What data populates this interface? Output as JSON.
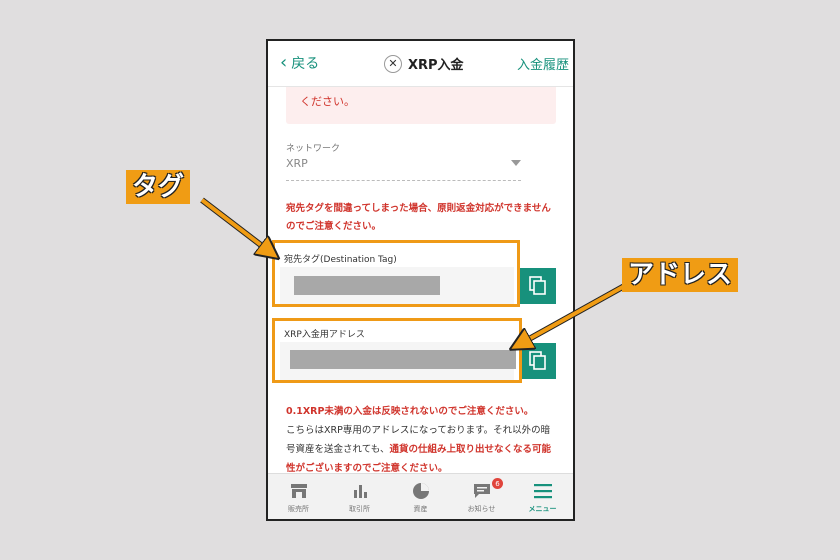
{
  "header": {
    "back_label": "戻る",
    "title": "XRP入金",
    "history_label": "入金履歴"
  },
  "warning_box": {
    "text": "ください。"
  },
  "network": {
    "label": "ネットワーク",
    "value": "XRP"
  },
  "tag_warning": "宛先タグを間違ってしまった場合、原則返金対応ができませんのでご注意ください。",
  "destination_tag": {
    "label": "宛先タグ(Destination Tag)"
  },
  "address": {
    "label": "XRP入金用アドレス"
  },
  "notes": {
    "line1": "0.1XRP未満の入金は反映されないのでご注意ください。",
    "line2a": "こちらはXRP専用のアドレスになっております。それ以外の暗号資産を送金されても、",
    "line2b": "通貨の仕組み上取り出せなくなる可能性がございますのでご注意ください。"
  },
  "tabbar": {
    "items": [
      {
        "label": "販売所",
        "icon": "store-icon"
      },
      {
        "label": "取引所",
        "icon": "bar-chart-icon"
      },
      {
        "label": "資産",
        "icon": "pie-chart-icon"
      },
      {
        "label": "お知らせ",
        "icon": "message-icon",
        "badge": "6"
      },
      {
        "label": "メニュー",
        "icon": "menu-icon",
        "active": true
      }
    ]
  },
  "callouts": {
    "tag": "タグ",
    "address": "アドレス"
  },
  "colors": {
    "accent": "#17917c",
    "warning": "#d0342c",
    "callout": "#f09c14"
  }
}
